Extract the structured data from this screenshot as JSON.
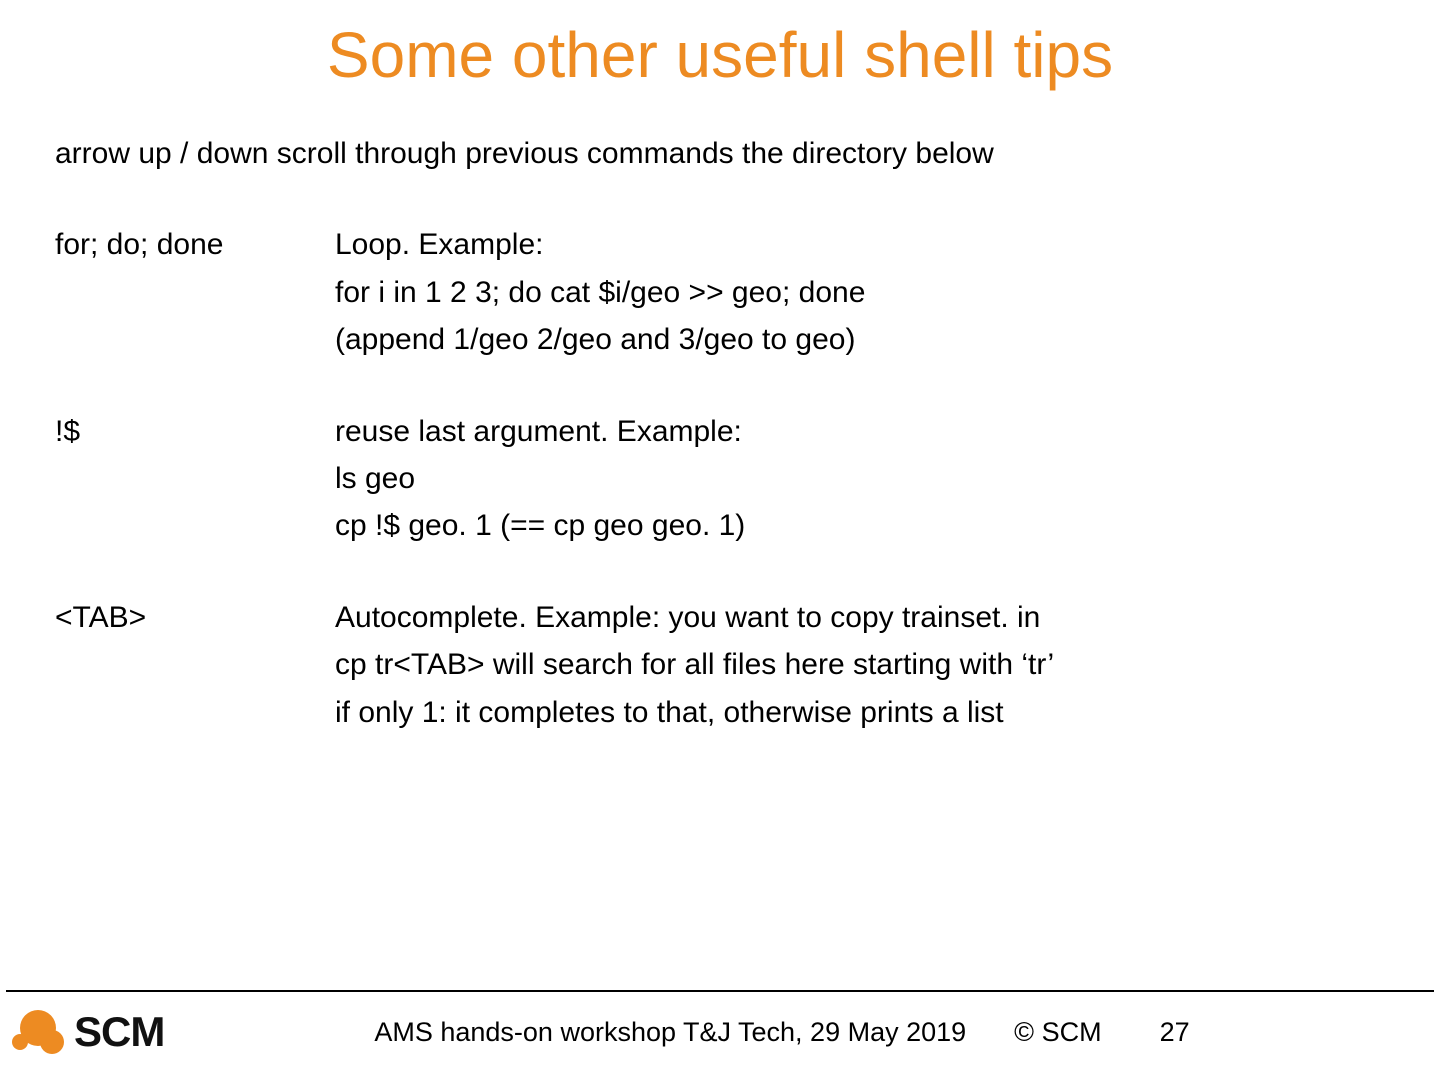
{
  "title": "Some other useful shell tips",
  "intro": "arrow up / down scroll through previous commands the directory below",
  "tips": [
    {
      "label": "for; do; done",
      "lines": [
        "Loop. Example:",
        "for i in 1 2 3; do cat $i/geo >> geo; done",
        "(append 1/geo 2/geo and 3/geo to geo)"
      ]
    },
    {
      "label": "!$",
      "lines": [
        "reuse last argument. Example:",
        "ls geo",
        "cp !$ geo. 1 (== cp geo geo. 1)"
      ]
    },
    {
      "label": "<TAB>",
      "lines": [
        "Autocomplete. Example: you want to copy trainset. in",
        "cp tr<TAB> will search for all files here starting with ‘tr’",
        "if only 1: it completes to that, otherwise prints a list"
      ]
    }
  ],
  "footer": {
    "logo_text": "SCM",
    "workshop": "AMS hands-on workshop T&J Tech, 29 May 2019",
    "copyright": "© SCM",
    "page": "27"
  }
}
